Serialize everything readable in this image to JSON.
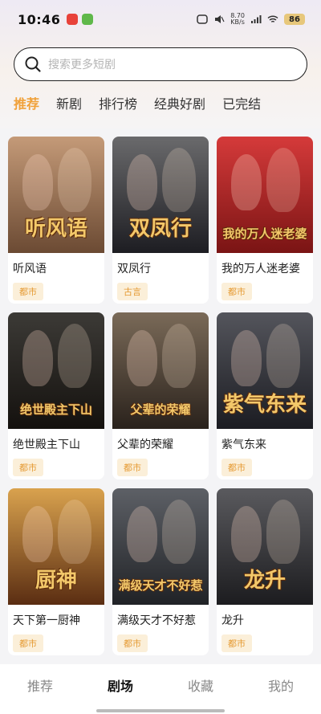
{
  "status_bar": {
    "time": "10:46",
    "net_speed_top": "8.70",
    "net_speed_bottom": "KB/s",
    "battery": "86"
  },
  "search": {
    "placeholder": "搜索更多短剧"
  },
  "tabs": [
    {
      "label": "推荐",
      "active": true
    },
    {
      "label": "新剧",
      "active": false
    },
    {
      "label": "排行榜",
      "active": false
    },
    {
      "label": "经典好剧",
      "active": false
    },
    {
      "label": "已完结",
      "active": false
    }
  ],
  "dramas": [
    {
      "title": "听风语",
      "tag": "都市",
      "poster_text": "听风语",
      "colors": [
        "#c49a78",
        "#6b4a33"
      ]
    },
    {
      "title": "双凤行",
      "tag": "古言",
      "poster_text": "双凤行",
      "colors": [
        "#6a6a6c",
        "#1d1d22"
      ]
    },
    {
      "title": "我的万人迷老婆",
      "tag": "都市",
      "poster_text": "我的万人迷老婆",
      "colors": [
        "#d53a3a",
        "#7a1414"
      ]
    },
    {
      "title": "绝世殿主下山",
      "tag": "都市",
      "poster_text": "绝世殿主下山",
      "colors": [
        "#3c3a36",
        "#14110e"
      ]
    },
    {
      "title": "父辈的荣耀",
      "tag": "都市",
      "poster_text": "父辈的荣耀",
      "colors": [
        "#7a6a58",
        "#2a221c"
      ]
    },
    {
      "title": "紫气东来",
      "tag": "都市",
      "poster_text": "紫气东来",
      "colors": [
        "#54555c",
        "#1b1c22"
      ]
    },
    {
      "title": "天下第一厨神",
      "tag": "都市",
      "poster_text": "厨神",
      "colors": [
        "#d9a24e",
        "#5a2d12"
      ]
    },
    {
      "title": "满级天才不好惹",
      "tag": "都市",
      "poster_text": "满级天才不好惹",
      "colors": [
        "#5d6066",
        "#202226"
      ]
    },
    {
      "title": "龙升",
      "tag": "都市",
      "poster_text": "龙升",
      "colors": [
        "#5a5a5e",
        "#1c1c1f"
      ]
    }
  ],
  "bottom_nav": [
    {
      "label": "推荐",
      "active": false
    },
    {
      "label": "剧场",
      "active": true
    },
    {
      "label": "收藏",
      "active": false
    },
    {
      "label": "我的",
      "active": false
    }
  ],
  "colors": {
    "accent": "#f0a13a",
    "tag_bg": "#fbefd9",
    "tag_text": "#e59a33"
  }
}
